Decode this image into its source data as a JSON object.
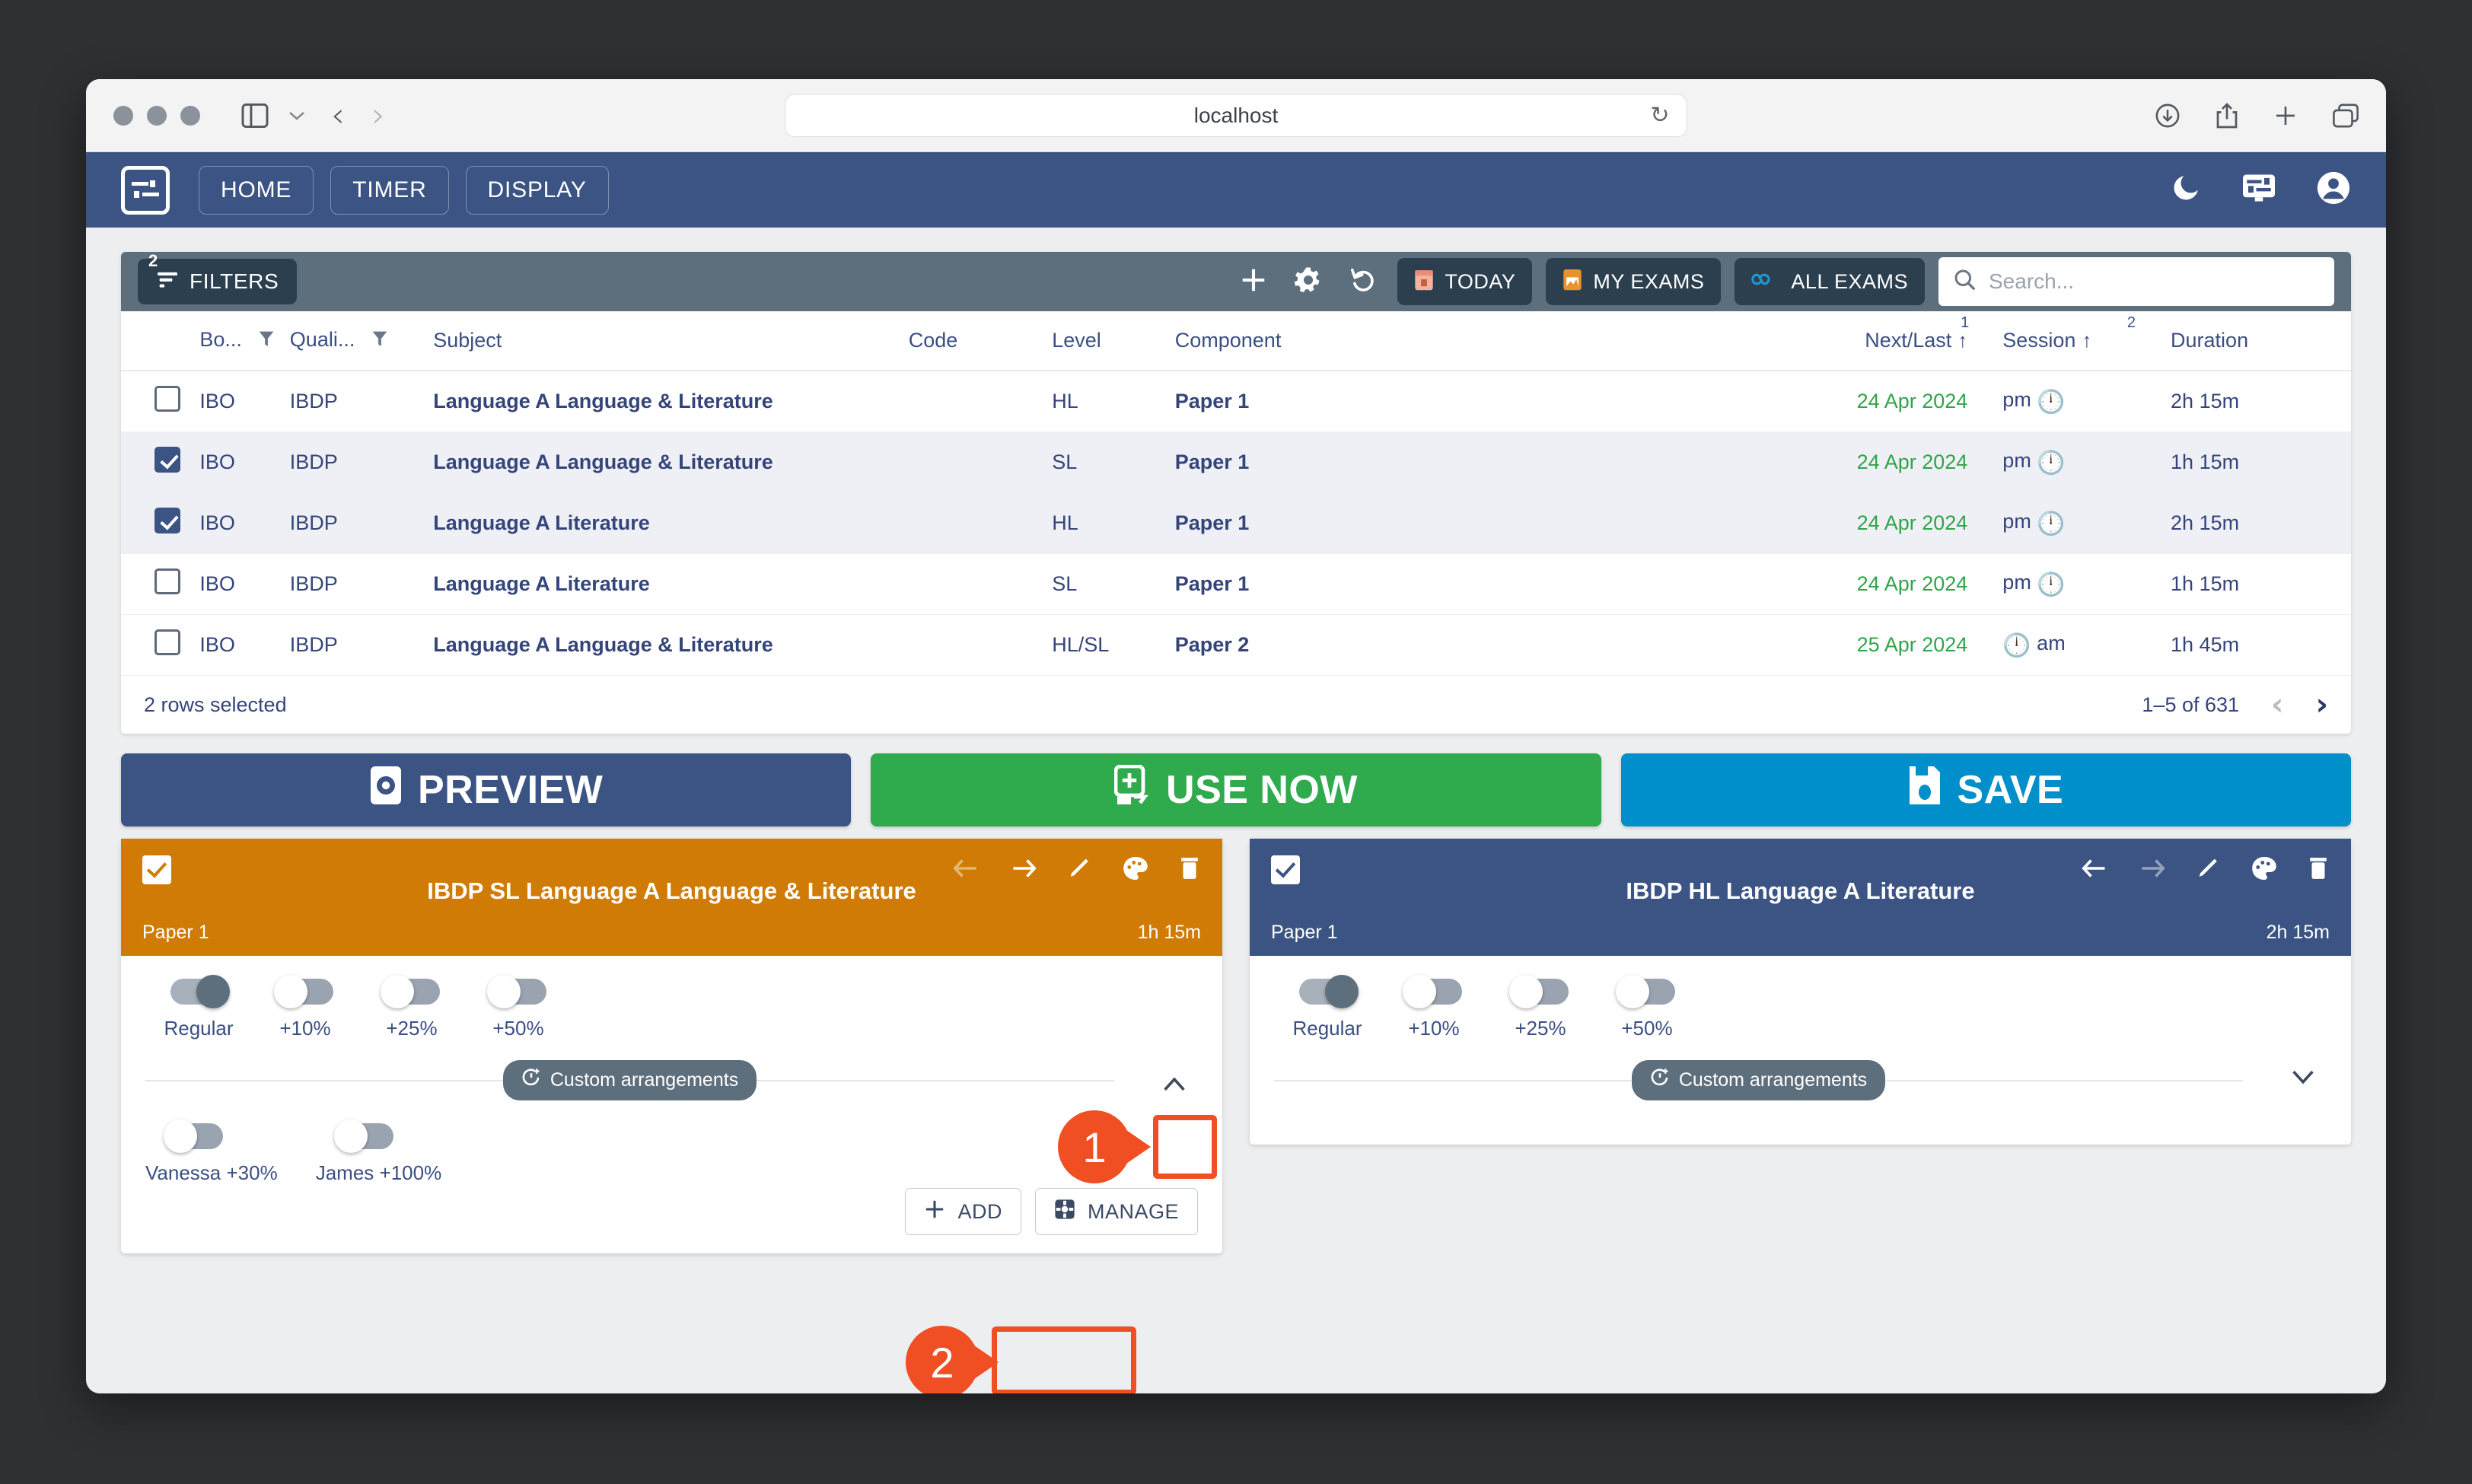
{
  "browser": {
    "url": "localhost",
    "reload_icon": "reload-icon",
    "sidebar_icon": "sidebar-toggle-icon",
    "back_icon": "back-chevron-icon",
    "forward_icon": "forward-chevron-icon",
    "download_icon": "downloads-icon",
    "share_icon": "share-icon",
    "newtab_icon": "new-tab-icon",
    "tabs_icon": "tab-overview-icon"
  },
  "appbar": {
    "logo_icon": "exam-timer-logo-icon",
    "nav": [
      {
        "label": "HOME",
        "name": "nav-home"
      },
      {
        "label": "TIMER",
        "name": "nav-timer"
      },
      {
        "label": "DISPLAY",
        "name": "nav-display"
      }
    ],
    "right_icons": [
      {
        "name": "dark-mode-icon",
        "glyph": "moon-icon"
      },
      {
        "name": "display-settings-icon",
        "glyph": "monitor-icon"
      },
      {
        "name": "account-icon",
        "glyph": "user-avatar-icon"
      }
    ]
  },
  "toolbar": {
    "filters_label": "FILTERS",
    "filters_badge": "2",
    "filters_icon": "filter-icon",
    "add_icon": "plus-icon",
    "settings_icon": "gear-icon",
    "reset_icon": "reset-icon",
    "today_label": "TODAY",
    "today_icon": "today-calendar-icon",
    "my_exams_label": "MY EXAMS",
    "my_exams_icon": "my-exams-icon",
    "all_exams_label": "ALL EXAMS",
    "all_exams_icon": "infinity-icon",
    "search_placeholder": "Search...",
    "search_value": "",
    "search_icon": "search-icon"
  },
  "table": {
    "columns": [
      {
        "label": "Bo...",
        "name": "col-board",
        "filter": true
      },
      {
        "label": "Quali...",
        "name": "col-qualification",
        "filter": true
      },
      {
        "label": "Subject",
        "name": "col-subject"
      },
      {
        "label": "Code",
        "name": "col-code"
      },
      {
        "label": "Level",
        "name": "col-level"
      },
      {
        "label": "Component",
        "name": "col-component"
      },
      {
        "label": "Next/Last",
        "name": "col-next-last",
        "sort": "↑",
        "sort_index": "1"
      },
      {
        "label": "Session",
        "name": "col-session",
        "sort": "↑",
        "sort_index": "2"
      },
      {
        "label": "Duration",
        "name": "col-duration"
      }
    ],
    "rows": [
      {
        "selected": false,
        "board": "IBO",
        "qualification": "IBDP",
        "subject": "Language A Language & Literature",
        "code": "",
        "level": "HL",
        "component": "Paper 1",
        "next_last": "24 Apr 2024",
        "session": "pm",
        "session_icon_side": "right",
        "duration": "2h 15m"
      },
      {
        "selected": true,
        "board": "IBO",
        "qualification": "IBDP",
        "subject": "Language A Language & Literature",
        "code": "",
        "level": "SL",
        "component": "Paper 1",
        "next_last": "24 Apr 2024",
        "session": "pm",
        "session_icon_side": "right",
        "duration": "1h 15m"
      },
      {
        "selected": true,
        "board": "IBO",
        "qualification": "IBDP",
        "subject": "Language A Literature",
        "code": "",
        "level": "HL",
        "component": "Paper 1",
        "next_last": "24 Apr 2024",
        "session": "pm",
        "session_icon_side": "right",
        "duration": "2h 15m"
      },
      {
        "selected": false,
        "board": "IBO",
        "qualification": "IBDP",
        "subject": "Language A Literature",
        "code": "",
        "level": "SL",
        "component": "Paper 1",
        "next_last": "24 Apr 2024",
        "session": "pm",
        "session_icon_side": "right",
        "duration": "1h 15m"
      },
      {
        "selected": false,
        "board": "IBO",
        "qualification": "IBDP",
        "subject": "Language A Language & Literature",
        "code": "",
        "level": "HL/SL",
        "component": "Paper 2",
        "next_last": "25 Apr 2024",
        "session": "am",
        "session_icon_side": "left",
        "duration": "1h 45m"
      }
    ],
    "footer": {
      "selection_text": "2 rows selected",
      "range_text": "1–5 of 631",
      "prev_icon": "prev-page-icon",
      "next_icon": "next-page-icon"
    }
  },
  "actions": [
    {
      "label": "PREVIEW",
      "name": "preview-button",
      "icon": "preview-eye-icon",
      "color": "#3b5484"
    },
    {
      "label": "USE NOW",
      "name": "use-now-button",
      "icon": "use-now-icon",
      "color": "#2faa4d"
    },
    {
      "label": "SAVE",
      "name": "save-button",
      "icon": "save-disk-icon",
      "color": "#008fca"
    }
  ],
  "cards": [
    {
      "name": "exam-card-sl",
      "title": "IBDP SL Language A Language & Literature",
      "component": "Paper 1",
      "duration": "1h 15m",
      "checked": true,
      "header_color": "#cf7b06",
      "icons": [
        {
          "name": "move-left-icon",
          "dim": true
        },
        {
          "name": "move-right-icon",
          "dim": false
        },
        {
          "name": "edit-pencil-icon",
          "dim": false
        },
        {
          "name": "palette-icon",
          "dim": false
        },
        {
          "name": "delete-trash-icon",
          "dim": false
        }
      ],
      "toggles": [
        {
          "label": "Regular",
          "on": true
        },
        {
          "label": "+10%",
          "on": false
        },
        {
          "label": "+25%",
          "on": false
        },
        {
          "label": "+50%",
          "on": false
        }
      ],
      "custom_chip": "Custom arrangements",
      "custom_chip_icon": "custom-time-icon",
      "expanded": true,
      "collapse_icon": "chevron-up-icon",
      "custom_toggles": [
        {
          "label": "Vanessa +30%",
          "on": false
        },
        {
          "label": "James +100%",
          "on": false
        }
      ],
      "add_label": "ADD",
      "add_icon": "plus-icon",
      "manage_label": "MANAGE",
      "manage_icon": "manage-gear-icon"
    },
    {
      "name": "exam-card-hl",
      "title": "IBDP HL Language A Literature",
      "component": "Paper 1",
      "duration": "2h 15m",
      "checked": true,
      "header_color": "#3b5484",
      "icons": [
        {
          "name": "move-left-icon",
          "dim": false
        },
        {
          "name": "move-right-icon",
          "dim": true
        },
        {
          "name": "edit-pencil-icon",
          "dim": false
        },
        {
          "name": "palette-icon",
          "dim": false
        },
        {
          "name": "delete-trash-icon",
          "dim": false
        }
      ],
      "toggles": [
        {
          "label": "Regular",
          "on": true
        },
        {
          "label": "+10%",
          "on": false
        },
        {
          "label": "+25%",
          "on": false
        },
        {
          "label": "+50%",
          "on": false
        }
      ],
      "custom_chip": "Custom arrangements",
      "custom_chip_icon": "custom-time-icon",
      "expanded": false,
      "collapse_icon": "chevron-down-icon",
      "custom_toggles": [],
      "add_label": "",
      "manage_label": ""
    }
  ],
  "annotations": [
    {
      "number": "1",
      "target": "collapse-toggle-button"
    },
    {
      "number": "2",
      "target": "add-arrangement-button"
    }
  ]
}
